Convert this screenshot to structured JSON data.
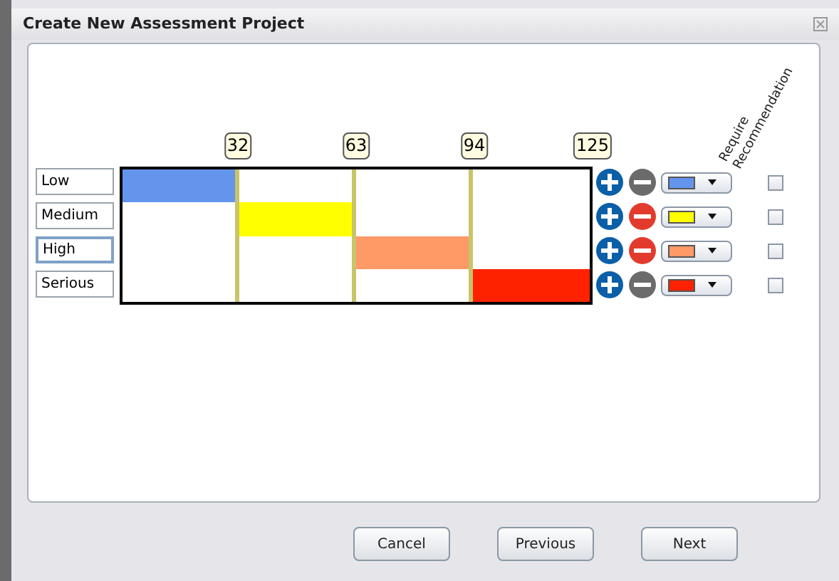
{
  "window": {
    "title": "Create New Assessment Project"
  },
  "thresholds": [
    "32",
    "63",
    "94",
    "125"
  ],
  "column_header": "Require Recommendation",
  "levels": [
    {
      "label": "Low",
      "color": "#6495ed",
      "remove_disabled": true,
      "checked": false,
      "selected": false
    },
    {
      "label": "Medium",
      "color": "#ffff00",
      "remove_disabled": false,
      "checked": false,
      "selected": false
    },
    {
      "label": "High",
      "color": "#ff9966",
      "remove_disabled": false,
      "checked": false,
      "selected": true
    },
    {
      "label": "Serious",
      "color": "#ff2200",
      "remove_disabled": true,
      "checked": false,
      "selected": false
    }
  ],
  "buttons": [
    "Cancel",
    "Previous",
    "Next"
  ]
}
